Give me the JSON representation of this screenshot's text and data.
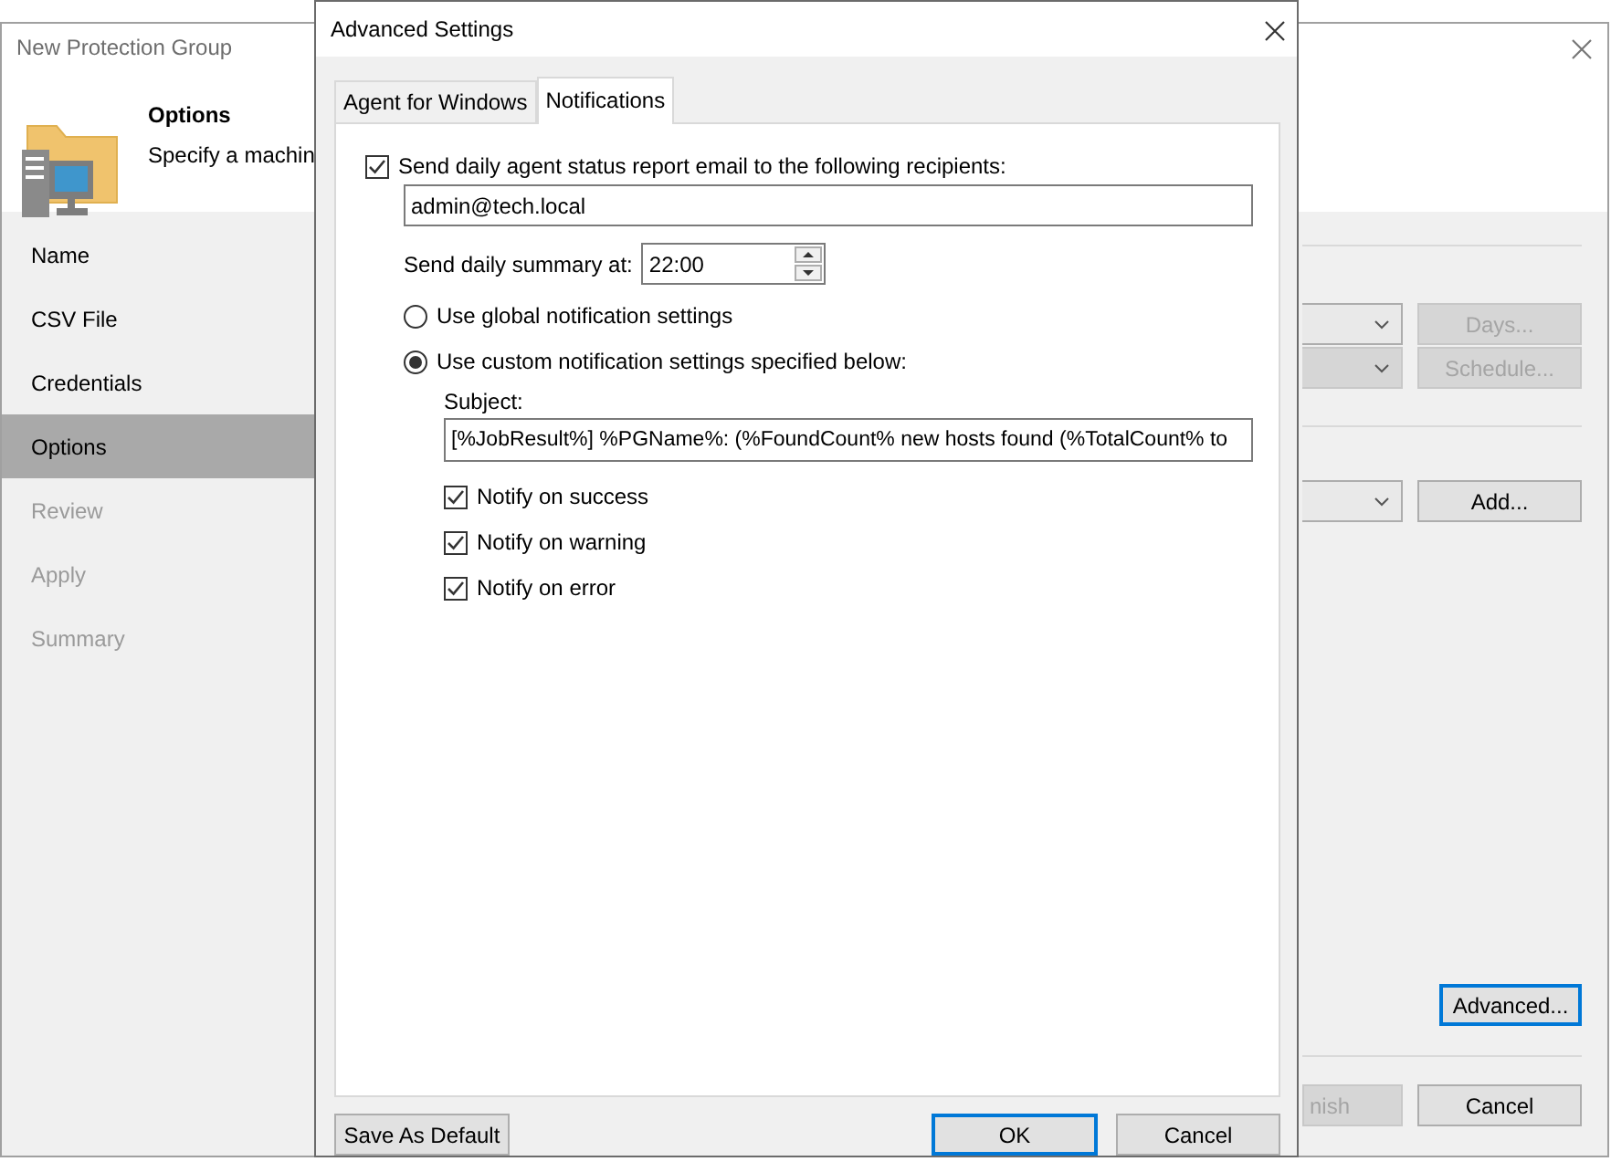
{
  "wizard": {
    "title": "New Protection Group",
    "header": {
      "title": "Options",
      "subtitle": "Specify a machin"
    },
    "steps": [
      {
        "label": "Name",
        "selected": false,
        "disabled": false
      },
      {
        "label": "CSV File",
        "selected": false,
        "disabled": false
      },
      {
        "label": "Credentials",
        "selected": false,
        "disabled": false
      },
      {
        "label": "Options",
        "selected": true,
        "disabled": false
      },
      {
        "label": "Review",
        "selected": false,
        "disabled": true
      },
      {
        "label": "Apply",
        "selected": false,
        "disabled": true
      },
      {
        "label": "Summary",
        "selected": false,
        "disabled": true
      }
    ],
    "settings_rows": [
      {
        "dropdown_disabled": false,
        "button": "Days...",
        "button_disabled": true
      },
      {
        "dropdown_disabled": true,
        "button": "Schedule...",
        "button_disabled": true
      },
      {
        "dropdown_disabled": false,
        "button": "Add...",
        "button_disabled": false
      }
    ],
    "advanced_button": "Advanced...",
    "footer_buttons": [
      {
        "label": "nish",
        "disabled": true
      },
      {
        "label": "Cancel",
        "disabled": false
      }
    ]
  },
  "dialog": {
    "title": "Advanced Settings",
    "tabs": [
      {
        "label": "Agent for Windows",
        "selected": false
      },
      {
        "label": "Notifications",
        "selected": true
      }
    ],
    "send_report": {
      "label": "Send daily agent status report email to the following recipients:",
      "checked": true
    },
    "recipients": "admin@tech.local",
    "summary_time": {
      "label": "Send daily summary at:",
      "value": "22:00"
    },
    "options": [
      {
        "label": "Use global notification settings",
        "selected": false
      },
      {
        "label": "Use custom notification settings specified below:",
        "selected": true
      }
    ],
    "subject": {
      "label": "Subject:",
      "value": "[%JobResult%] %PGName%: (%FoundCount% new hosts found (%TotalCount% to"
    },
    "notify": [
      {
        "label": "Notify on success",
        "checked": true
      },
      {
        "label": "Notify on warning",
        "checked": true
      },
      {
        "label": "Notify on error",
        "checked": true
      }
    ],
    "buttons": [
      {
        "label": "Save As Default",
        "focused": false
      },
      {
        "label": "OK",
        "focused": true
      },
      {
        "label": "Cancel",
        "focused": false
      }
    ]
  }
}
